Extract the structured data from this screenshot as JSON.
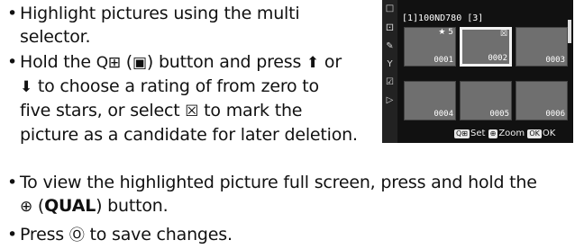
{
  "bullets": [
    {
      "lines": [
        "Highlight pictures using the multi",
        "selector."
      ]
    },
    {
      "lines": [
        {
          "pre": "Hold the ",
          "g1": "Q⊞",
          "mid": " (",
          "g2": "▣",
          "post": ") button and press ",
          "g3": "⬆",
          "tail": " or"
        },
        {
          "g1": "⬇",
          "post": " to choose a rating of from zero to"
        },
        {
          "pre": "five stars, or select ",
          "g1": "☒",
          "post": " to mark the"
        },
        {
          "pre": "picture as a candidate for later deletion."
        }
      ]
    },
    {
      "lines": [
        {
          "pre": "To view the highlighted picture full screen, press and hold the"
        },
        {
          "g1": "⊕",
          "pre": " (",
          "bold": "QUAL",
          "post": ") button."
        }
      ]
    },
    {
      "lines": [
        {
          "pre": "Press ",
          "g1": "Ⓞ",
          "post": " to save changes."
        }
      ]
    }
  ],
  "screen": {
    "folder": "[1]100ND780 [3]",
    "thumbs": [
      {
        "num": "0001",
        "rating": "★ 5"
      },
      {
        "num": "0002",
        "rating": "☒"
      },
      {
        "num": "0003",
        "rating": ""
      },
      {
        "num": "0004",
        "rating": ""
      },
      {
        "num": "0005",
        "rating": ""
      },
      {
        "num": "0006",
        "rating": ""
      }
    ],
    "help_set_key": "Q⊞",
    "help_set": "Set",
    "help_zoom_key": "⊕",
    "help_zoom": "Zoom",
    "help_ok_key": "OK",
    "help_ok": "OK",
    "side_icons": [
      "□",
      "⚀",
      "✎",
      "Y",
      "☑",
      "▷"
    ]
  }
}
